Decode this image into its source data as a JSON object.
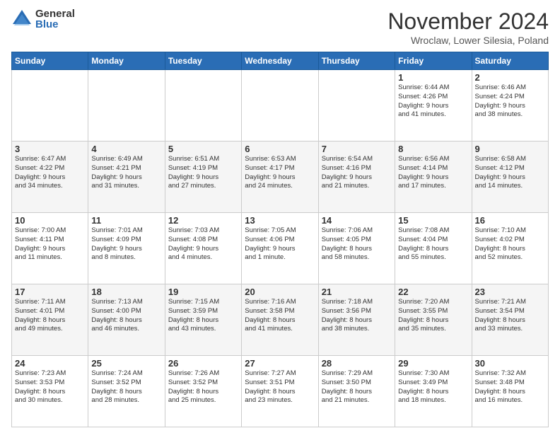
{
  "logo": {
    "general": "General",
    "blue": "Blue"
  },
  "title": "November 2024",
  "subtitle": "Wroclaw, Lower Silesia, Poland",
  "days_header": [
    "Sunday",
    "Monday",
    "Tuesday",
    "Wednesday",
    "Thursday",
    "Friday",
    "Saturday"
  ],
  "weeks": [
    [
      {
        "day": "",
        "info": ""
      },
      {
        "day": "",
        "info": ""
      },
      {
        "day": "",
        "info": ""
      },
      {
        "day": "",
        "info": ""
      },
      {
        "day": "",
        "info": ""
      },
      {
        "day": "1",
        "info": "Sunrise: 6:44 AM\nSunset: 4:26 PM\nDaylight: 9 hours\nand 41 minutes."
      },
      {
        "day": "2",
        "info": "Sunrise: 6:46 AM\nSunset: 4:24 PM\nDaylight: 9 hours\nand 38 minutes."
      }
    ],
    [
      {
        "day": "3",
        "info": "Sunrise: 6:47 AM\nSunset: 4:22 PM\nDaylight: 9 hours\nand 34 minutes."
      },
      {
        "day": "4",
        "info": "Sunrise: 6:49 AM\nSunset: 4:21 PM\nDaylight: 9 hours\nand 31 minutes."
      },
      {
        "day": "5",
        "info": "Sunrise: 6:51 AM\nSunset: 4:19 PM\nDaylight: 9 hours\nand 27 minutes."
      },
      {
        "day": "6",
        "info": "Sunrise: 6:53 AM\nSunset: 4:17 PM\nDaylight: 9 hours\nand 24 minutes."
      },
      {
        "day": "7",
        "info": "Sunrise: 6:54 AM\nSunset: 4:16 PM\nDaylight: 9 hours\nand 21 minutes."
      },
      {
        "day": "8",
        "info": "Sunrise: 6:56 AM\nSunset: 4:14 PM\nDaylight: 9 hours\nand 17 minutes."
      },
      {
        "day": "9",
        "info": "Sunrise: 6:58 AM\nSunset: 4:12 PM\nDaylight: 9 hours\nand 14 minutes."
      }
    ],
    [
      {
        "day": "10",
        "info": "Sunrise: 7:00 AM\nSunset: 4:11 PM\nDaylight: 9 hours\nand 11 minutes."
      },
      {
        "day": "11",
        "info": "Sunrise: 7:01 AM\nSunset: 4:09 PM\nDaylight: 9 hours\nand 8 minutes."
      },
      {
        "day": "12",
        "info": "Sunrise: 7:03 AM\nSunset: 4:08 PM\nDaylight: 9 hours\nand 4 minutes."
      },
      {
        "day": "13",
        "info": "Sunrise: 7:05 AM\nSunset: 4:06 PM\nDaylight: 9 hours\nand 1 minute."
      },
      {
        "day": "14",
        "info": "Sunrise: 7:06 AM\nSunset: 4:05 PM\nDaylight: 8 hours\nand 58 minutes."
      },
      {
        "day": "15",
        "info": "Sunrise: 7:08 AM\nSunset: 4:04 PM\nDaylight: 8 hours\nand 55 minutes."
      },
      {
        "day": "16",
        "info": "Sunrise: 7:10 AM\nSunset: 4:02 PM\nDaylight: 8 hours\nand 52 minutes."
      }
    ],
    [
      {
        "day": "17",
        "info": "Sunrise: 7:11 AM\nSunset: 4:01 PM\nDaylight: 8 hours\nand 49 minutes."
      },
      {
        "day": "18",
        "info": "Sunrise: 7:13 AM\nSunset: 4:00 PM\nDaylight: 8 hours\nand 46 minutes."
      },
      {
        "day": "19",
        "info": "Sunrise: 7:15 AM\nSunset: 3:59 PM\nDaylight: 8 hours\nand 43 minutes."
      },
      {
        "day": "20",
        "info": "Sunrise: 7:16 AM\nSunset: 3:58 PM\nDaylight: 8 hours\nand 41 minutes."
      },
      {
        "day": "21",
        "info": "Sunrise: 7:18 AM\nSunset: 3:56 PM\nDaylight: 8 hours\nand 38 minutes."
      },
      {
        "day": "22",
        "info": "Sunrise: 7:20 AM\nSunset: 3:55 PM\nDaylight: 8 hours\nand 35 minutes."
      },
      {
        "day": "23",
        "info": "Sunrise: 7:21 AM\nSunset: 3:54 PM\nDaylight: 8 hours\nand 33 minutes."
      }
    ],
    [
      {
        "day": "24",
        "info": "Sunrise: 7:23 AM\nSunset: 3:53 PM\nDaylight: 8 hours\nand 30 minutes."
      },
      {
        "day": "25",
        "info": "Sunrise: 7:24 AM\nSunset: 3:52 PM\nDaylight: 8 hours\nand 28 minutes."
      },
      {
        "day": "26",
        "info": "Sunrise: 7:26 AM\nSunset: 3:52 PM\nDaylight: 8 hours\nand 25 minutes."
      },
      {
        "day": "27",
        "info": "Sunrise: 7:27 AM\nSunset: 3:51 PM\nDaylight: 8 hours\nand 23 minutes."
      },
      {
        "day": "28",
        "info": "Sunrise: 7:29 AM\nSunset: 3:50 PM\nDaylight: 8 hours\nand 21 minutes."
      },
      {
        "day": "29",
        "info": "Sunrise: 7:30 AM\nSunset: 3:49 PM\nDaylight: 8 hours\nand 18 minutes."
      },
      {
        "day": "30",
        "info": "Sunrise: 7:32 AM\nSunset: 3:48 PM\nDaylight: 8 hours\nand 16 minutes."
      }
    ]
  ]
}
